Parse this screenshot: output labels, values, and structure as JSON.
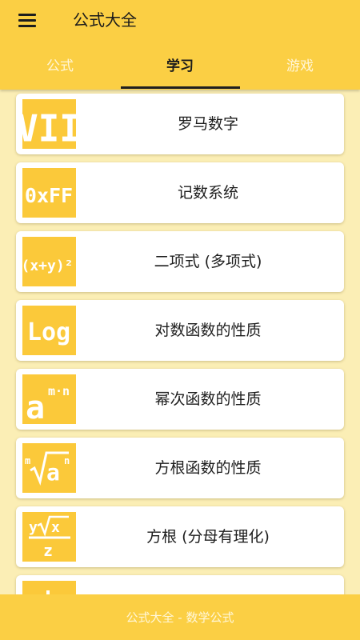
{
  "app": {
    "title": "公式大全"
  },
  "tabs": [
    {
      "label": "公式",
      "active": false
    },
    {
      "label": "学习",
      "active": true
    },
    {
      "label": "游戏",
      "active": false
    }
  ],
  "items": [
    {
      "label": "罗马数字",
      "icon_text": "VII",
      "icon": "roman-numeral-icon"
    },
    {
      "label": "记数系统",
      "icon_text": "0xFF",
      "icon": "hex-number-icon"
    },
    {
      "label": "二项式 (多项式)",
      "icon_text": "(x+y)²",
      "icon": "binomial-icon"
    },
    {
      "label": "对数函数的性质",
      "icon_text": "Log",
      "icon": "logarithm-icon"
    },
    {
      "label": "幂次函数的性质",
      "icon_text": "a^m·n",
      "icon": "power-icon"
    },
    {
      "label": "方根函数的性质",
      "icon_text": "ᵐ√aⁿ",
      "icon": "root-icon"
    },
    {
      "label": "方根 (分母有理化)",
      "icon_text": "y√x / z",
      "icon": "rationalize-icon"
    },
    {
      "label": "",
      "icon_text": "",
      "icon": "partial-item-icon"
    }
  ],
  "footer": {
    "text": "公式大全 - 数学公式"
  },
  "colors": {
    "primary": "#fbcf44",
    "background": "#fbeeb5",
    "icon_bg": "#fbc93a",
    "card": "#ffffff",
    "text": "#1e1e1e"
  }
}
